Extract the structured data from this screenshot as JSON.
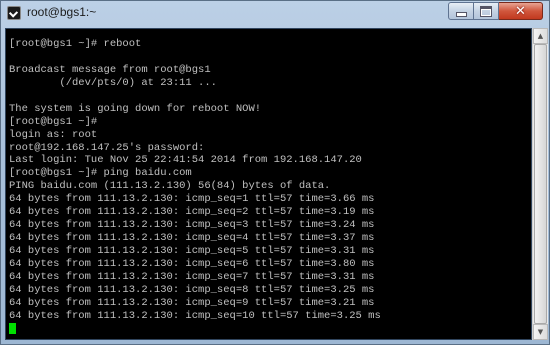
{
  "window": {
    "title": "root@bgs1:~",
    "minimize_glyph": "",
    "close_glyph": "✕"
  },
  "terminal": {
    "lines": [
      "[root@bgs1 ~]# reboot",
      "",
      "Broadcast message from root@bgs1",
      "        (/dev/pts/0) at 23:11 ...",
      "",
      "The system is going down for reboot NOW!",
      "[root@bgs1 ~]#",
      "login as: root",
      "root@192.168.147.25's password:",
      "Last login: Tue Nov 25 22:41:54 2014 from 192.168.147.20",
      "[root@bgs1 ~]# ping baidu.com",
      "PING baidu.com (111.13.2.130) 56(84) bytes of data.",
      "64 bytes from 111.13.2.130: icmp_seq=1 ttl=57 time=3.66 ms",
      "64 bytes from 111.13.2.130: icmp_seq=2 ttl=57 time=3.19 ms",
      "64 bytes from 111.13.2.130: icmp_seq=3 ttl=57 time=3.24 ms",
      "64 bytes from 111.13.2.130: icmp_seq=4 ttl=57 time=3.37 ms",
      "64 bytes from 111.13.2.130: icmp_seq=5 ttl=57 time=3.31 ms",
      "64 bytes from 111.13.2.130: icmp_seq=6 ttl=57 time=3.80 ms",
      "64 bytes from 111.13.2.130: icmp_seq=7 ttl=57 time=3.31 ms",
      "64 bytes from 111.13.2.130: icmp_seq=8 ttl=57 time=3.25 ms",
      "64 bytes from 111.13.2.130: icmp_seq=9 ttl=57 time=3.21 ms",
      "64 bytes from 111.13.2.130: icmp_seq=10 ttl=57 time=3.25 ms"
    ],
    "text_color": "#c0c0c0",
    "background_color": "#000000",
    "cursor_color": "#00e000"
  },
  "scrollbar": {
    "thumb_start_fraction": 0.0,
    "thumb_size_fraction": 1.0
  }
}
